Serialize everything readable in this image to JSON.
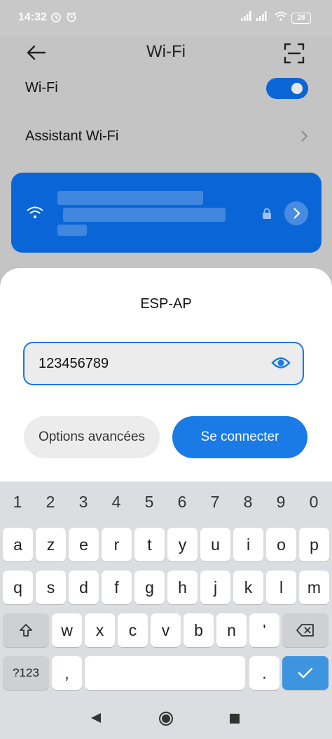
{
  "status_bar": {
    "time": "14:32",
    "battery": "28"
  },
  "header": {
    "title": "Wi-Fi",
    "back_icon": "arrow-left-icon",
    "scan_icon": "qr-scan-icon"
  },
  "settings": {
    "wifi_label": "Wi-Fi",
    "wifi_enabled": true,
    "assistant_label": "Assistant Wi-Fi"
  },
  "connected_network": {
    "accent": "#0a66d6"
  },
  "dialog": {
    "ssid": "ESP-AP",
    "password_value": "123456789",
    "advanced_label": "Options avancées",
    "connect_label": "Se connecter",
    "accent": "#1a7ae6"
  },
  "keyboard": {
    "numbers": [
      "1",
      "2",
      "3",
      "4",
      "5",
      "6",
      "7",
      "8",
      "9",
      "0"
    ],
    "row1": [
      "a",
      "z",
      "e",
      "r",
      "t",
      "y",
      "u",
      "i",
      "o",
      "p"
    ],
    "row2": [
      "q",
      "s",
      "d",
      "f",
      "g",
      "h",
      "j",
      "k",
      "l",
      "m"
    ],
    "row3": [
      "w",
      "x",
      "c",
      "v",
      "b",
      "n",
      "'"
    ],
    "symbols_label": "?123",
    "comma": ",",
    "period": "."
  }
}
